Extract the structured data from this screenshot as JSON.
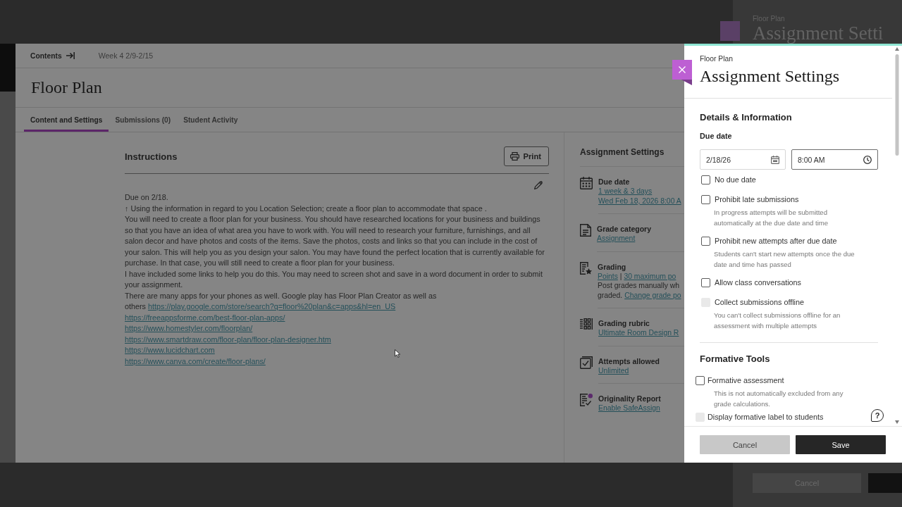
{
  "background_panel": {
    "subtitle": "Floor Plan",
    "title": "Assignment Setti",
    "button": "Cancel"
  },
  "breadcrumb": {
    "contents": "Contents",
    "week": "Week 4 2/9-2/15"
  },
  "page_title": "Floor Plan",
  "tabs": [
    {
      "label": "Content and Settings",
      "selected": true
    },
    {
      "label": "Submissions (0)",
      "selected": false
    },
    {
      "label": "Student Activity",
      "selected": false
    }
  ],
  "instructions": {
    "heading": "Instructions",
    "print": "Print",
    "body": [
      {
        "kind": "text",
        "text": "Due on 2/18."
      },
      {
        "kind": "text",
        "text": "↑ Using the information in regard to you Location Selection; create a floor plan to accommodate that space ."
      },
      {
        "kind": "text",
        "text": "You will need to create a floor plan for your business. You should have researched locations for your business and buildings so that you have an idea of what area you have to work with. You will need to research your furniture, furnishings, and all salon decor and have photos and costs of the items. Save the photos, costs and links so that you can include in the cost of your salon. This will help you as you design your salon. You may have found the perfect location that is currently available for purchase. In that case, you will still need to create a floor plan for your business."
      },
      {
        "kind": "text",
        "text": "I have included some links to help you do this. You may need to screen shot and save in a word document in order to submit your assignment."
      },
      {
        "kind": "text",
        "text": "There are many apps for your phones as well. Google play has Floor Plan Creator as well as"
      },
      {
        "kind": "text_link",
        "text": "others",
        "link": "https://play.google.com/store/search?q=floor%20plan&c=apps&hl=en_US"
      },
      {
        "kind": "link",
        "link": "https://freeappsforme.com/best-floor-plan-apps/"
      },
      {
        "kind": "link",
        "link": "https://www.homestyler.com/floorplan/"
      },
      {
        "kind": "link",
        "link": "https://www.smartdraw.com/floor-plan/floor-plan-designer.htm"
      },
      {
        "kind": "link",
        "link": "https://www.lucidchart.com"
      },
      {
        "kind": "link",
        "link": "https://www.canva.com/create/floor-plans/"
      }
    ]
  },
  "settings_summary": {
    "heading": "Assignment Settings",
    "items": [
      {
        "kind": "due_date",
        "title": "Due date",
        "lines": [
          [
            {
              "kind": "link",
              "text": "1 week & 3 days"
            }
          ],
          [
            {
              "kind": "link",
              "text": "Wed Feb 18, 2026 8:00 A"
            }
          ]
        ]
      },
      {
        "kind": "grade_category",
        "title": "Grade category",
        "lines": [
          [
            {
              "kind": "link",
              "text": "Assignment"
            }
          ]
        ]
      },
      {
        "kind": "grading",
        "title": "Grading",
        "lines": [
          [
            {
              "kind": "link",
              "text": "Points"
            },
            {
              "kind": "text",
              "text": "|"
            },
            {
              "kind": "link",
              "text": "30 maximum po"
            }
          ],
          [
            {
              "kind": "text",
              "text": "Post grades manually wh"
            }
          ],
          [
            {
              "kind": "text",
              "text": "graded."
            },
            {
              "kind": "link",
              "text": "Change grade po"
            }
          ]
        ]
      },
      {
        "kind": "rubric",
        "title": "Grading rubric",
        "lines": [
          [
            {
              "kind": "link",
              "text": "Ultimate Room Design R"
            }
          ]
        ]
      },
      {
        "kind": "attempts",
        "title": "Attempts allowed",
        "lines": [
          [
            {
              "kind": "link",
              "text": "Unlimited"
            }
          ]
        ]
      },
      {
        "kind": "originality",
        "title": "Originality Report",
        "lines": [
          [
            {
              "kind": "link",
              "text": "Enable SafeAssign"
            }
          ]
        ]
      }
    ]
  },
  "settings_panel": {
    "subtitle": "Floor Plan",
    "title": "Assignment Settings",
    "details": {
      "heading": "Details & Information",
      "due_date_label": "Due date",
      "date_field": {
        "value": "2/18/26",
        "focused": false
      },
      "time_field": {
        "value": "8:00 AM",
        "focused": true
      },
      "options": [
        {
          "label": "No due date",
          "checked": false,
          "disabled": false
        },
        {
          "label": "Prohibit late submissions",
          "description": "In progress attempts will be submitted automatically at the due date and time",
          "checked": false,
          "disabled": false
        },
        {
          "label": "Prohibit new attempts after due date",
          "description": "Students can't start new attempts once the due date and time has passed",
          "checked": false,
          "disabled": false
        },
        {
          "label": "Allow class conversations",
          "checked": false,
          "disabled": false
        },
        {
          "label": "Collect submissions offline",
          "description": "You can't collect submissions offline for an assessment with multiple attempts",
          "checked": false,
          "disabled": true
        }
      ]
    },
    "formative": {
      "heading": "Formative Tools",
      "options": [
        {
          "label": "Formative assessment",
          "description": "This is not automatically excluded from any grade calculations.",
          "checked": false,
          "disabled": false
        },
        {
          "label": "Display formative label to students",
          "checked": false,
          "disabled": true
        }
      ]
    },
    "help": "?",
    "cancel": "Cancel",
    "save": "Save"
  }
}
